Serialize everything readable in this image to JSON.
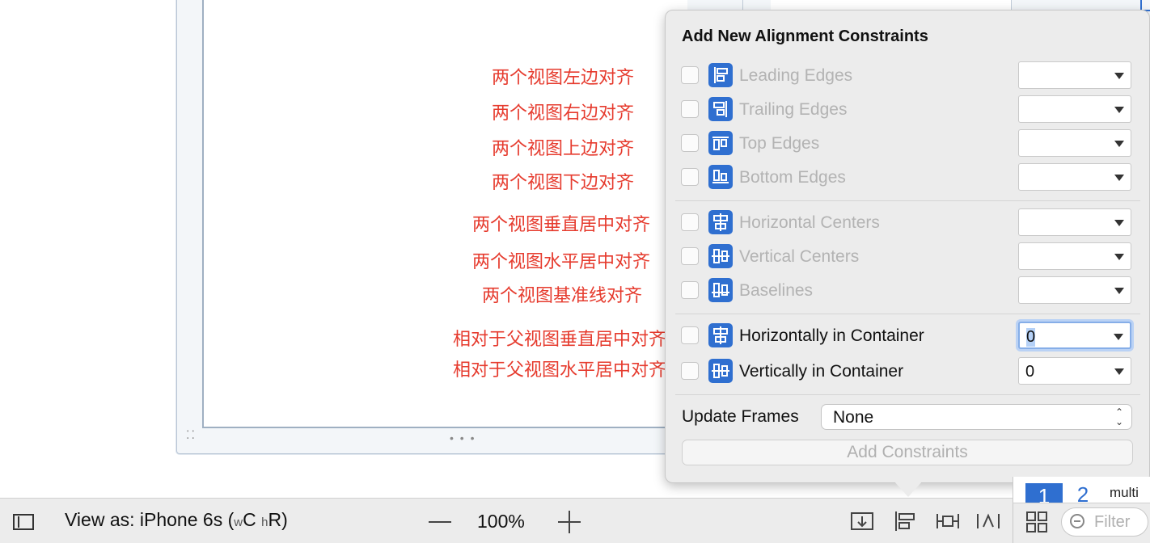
{
  "annotations": [
    "两个视图左边对齐",
    "两个视图右边对齐",
    "两个视图上边对齐",
    "两个视图下边对齐",
    "两个视图垂直居中对齐",
    "两个视图水平居中对齐",
    "两个视图基准线对齐",
    "相对于父视图垂直居中对齐",
    "相对于父视图水平居中对齐"
  ],
  "popover": {
    "title": "Add New Alignment Constraints",
    "rows": [
      {
        "label": "Leading Edges",
        "enabled": false,
        "icon": "leading-edges-icon",
        "value": ""
      },
      {
        "label": "Trailing Edges",
        "enabled": false,
        "icon": "trailing-edges-icon",
        "value": ""
      },
      {
        "label": "Top Edges",
        "enabled": false,
        "icon": "top-edges-icon",
        "value": ""
      },
      {
        "label": "Bottom Edges",
        "enabled": false,
        "icon": "bottom-edges-icon",
        "value": ""
      },
      {
        "label": "Horizontal Centers",
        "enabled": false,
        "icon": "horizontal-centers-icon",
        "value": ""
      },
      {
        "label": "Vertical Centers",
        "enabled": false,
        "icon": "vertical-centers-icon",
        "value": ""
      },
      {
        "label": "Baselines",
        "enabled": false,
        "icon": "baselines-icon",
        "value": ""
      },
      {
        "label": "Horizontally in Container",
        "enabled": true,
        "icon": "horizontally-in-container-icon",
        "value": "0"
      },
      {
        "label": "Vertically in Container",
        "enabled": true,
        "icon": "vertically-in-container-icon",
        "value": "0"
      }
    ],
    "update_frames_label": "Update Frames",
    "update_frames_value": "None",
    "add_button_label": "Add Constraints"
  },
  "toolbar": {
    "view_as_prefix": "View as: iPhone 6s (",
    "size_w": "w",
    "size_c": "C",
    "size_h": "h",
    "size_r": "R",
    "view_as_suffix": ")",
    "zoom": "100%"
  },
  "right_panel": {
    "badge1": "1",
    "badge2": "2",
    "text": "multi",
    "filter_placeholder": "Filter"
  },
  "colors": {
    "annotation": "#e63b2e",
    "accent": "#2f6fd0",
    "disabled_text": "#b3b3b3"
  }
}
